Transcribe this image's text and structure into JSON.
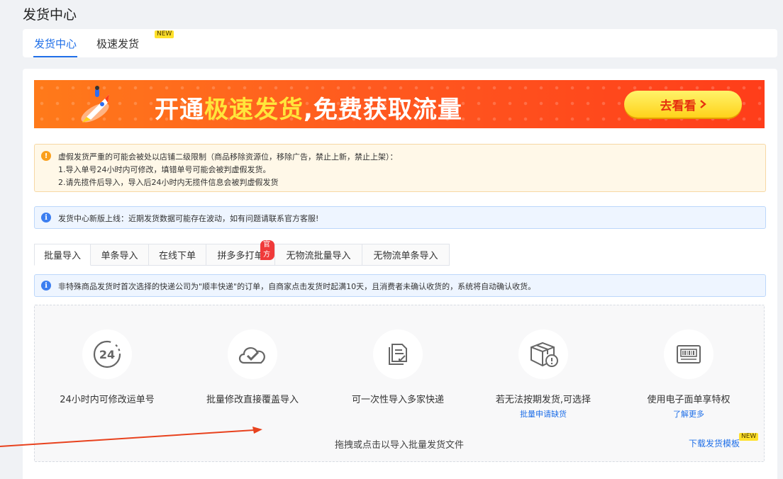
{
  "page": {
    "title": "发货中心"
  },
  "top_tabs": [
    {
      "label": "发货中心",
      "active": true
    },
    {
      "label": "极速发货",
      "badge": "NEW"
    }
  ],
  "banner": {
    "text_prefix": "开通",
    "text_highlight": "极速发货",
    "text_suffix": ",免费获取流量",
    "button_label": "去看看",
    "button_icon": "chevron-right-icon",
    "illustration": "rocket-icon"
  },
  "warning": {
    "icon": "warning-icon",
    "line1": "虚假发货严重的可能会被处以店铺二级限制（商品移除资源位，移除广告，禁止上新，禁止上架）：",
    "line2": "1.导入单号24小时内可修改，填错单号可能会被判虚假发货。",
    "line3": "2.请先揽件后导入，导入后24小时内无揽件信息会被判虚假发货"
  },
  "notice": {
    "icon": "info-icon",
    "text": "发货中心新版上线：近期发货数据可能存在波动，如有问题请联系官方客服!"
  },
  "sub_tabs": [
    {
      "label": "批量导入",
      "active": true
    },
    {
      "label": "单条导入"
    },
    {
      "label": "在线下单"
    },
    {
      "label": "拼多多打单",
      "badge": "官方"
    },
    {
      "label": "无物流批量导入"
    },
    {
      "label": "无物流单条导入"
    }
  ],
  "sub_notice": {
    "icon": "info-icon",
    "text": "非特殊商品发货时首次选择的快递公司为\"顺丰快递\"的订单，自商家点击发货时起满10天，且消费者未确认收货的，系统将自动确认收货。"
  },
  "features": [
    {
      "icon": "24h-clock-icon",
      "icon_text": "24",
      "label": "24小时内可修改运单号"
    },
    {
      "icon": "cloud-check-icon",
      "label": "批量修改直接覆盖导入"
    },
    {
      "icon": "document-import-icon",
      "label": "可一次性导入多家快递"
    },
    {
      "icon": "package-warning-icon",
      "label": "若无法按期发货,可选择",
      "link": "批量申请缺货"
    },
    {
      "icon": "barcode-printer-icon",
      "label": "使用电子面单享特权",
      "link": "了解更多"
    }
  ],
  "drop_hint": "拖拽或点击以导入批量发货文件",
  "template_link": {
    "label": "下载发货模板",
    "badge": "NEW"
  },
  "colors": {
    "primary": "#1f6fe8",
    "warning": "#faa01e",
    "danger": "#f03a3a",
    "annotation_arrow": "#e8421e"
  }
}
